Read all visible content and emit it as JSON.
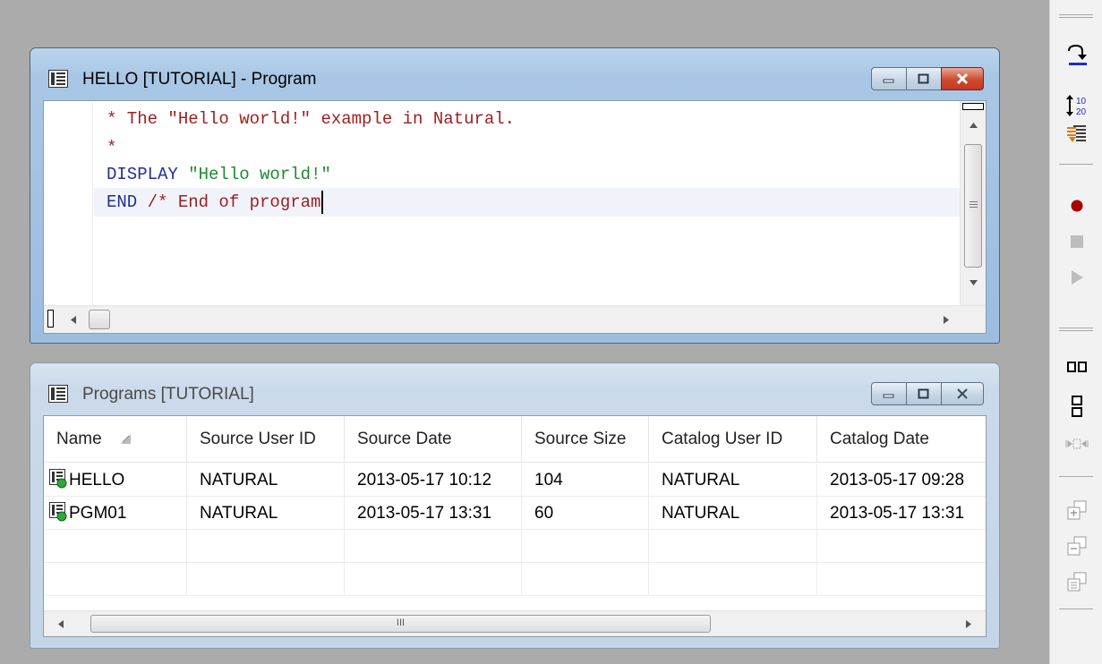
{
  "editor_window": {
    "title": "HELLO [TUTORIAL] - Program",
    "code": {
      "line1": {
        "comment": "* The \"Hello world!\" example in Natural."
      },
      "line2": {
        "comment": "*"
      },
      "line3": {
        "keyword": "DISPLAY ",
        "string": "\"Hello world!\""
      },
      "line4": {
        "keyword": "END ",
        "comment": "/* End of program"
      }
    },
    "colors": {
      "comment": "#a01e1e",
      "keyword": "#1f2f9c",
      "string": "#1d8a2e"
    }
  },
  "programs_window": {
    "title": "Programs  [TUTORIAL]",
    "columns": [
      "Name",
      "Source User ID",
      "Source Date",
      "Source Size",
      "Catalog User ID",
      "Catalog Date"
    ],
    "rows": [
      {
        "name": "HELLO",
        "source_user": "NATURAL",
        "source_date": "2013-05-17 10:12",
        "source_size": "104",
        "catalog_user": "NATURAL",
        "catalog_date": "2013-05-17 09:28"
      },
      {
        "name": "PGM01",
        "source_user": "NATURAL",
        "source_date": "2013-05-17 13:31",
        "source_size": "60",
        "catalog_user": "NATURAL",
        "catalog_date": "2013-05-17 13:31"
      }
    ],
    "scroll_thumb_label": "III"
  },
  "toolbar": {
    "icons": [
      "step-over-icon",
      "line-numbers-icon",
      "step-into-icon",
      "record-icon",
      "stop-icon",
      "play-icon",
      "tile-horizontal-icon",
      "tile-vertical-icon",
      "arrange-icon",
      "new-window-icon",
      "cascade-icon",
      "window-list-icon"
    ],
    "line_numbers_top": "10",
    "line_numbers_bottom": "20"
  }
}
